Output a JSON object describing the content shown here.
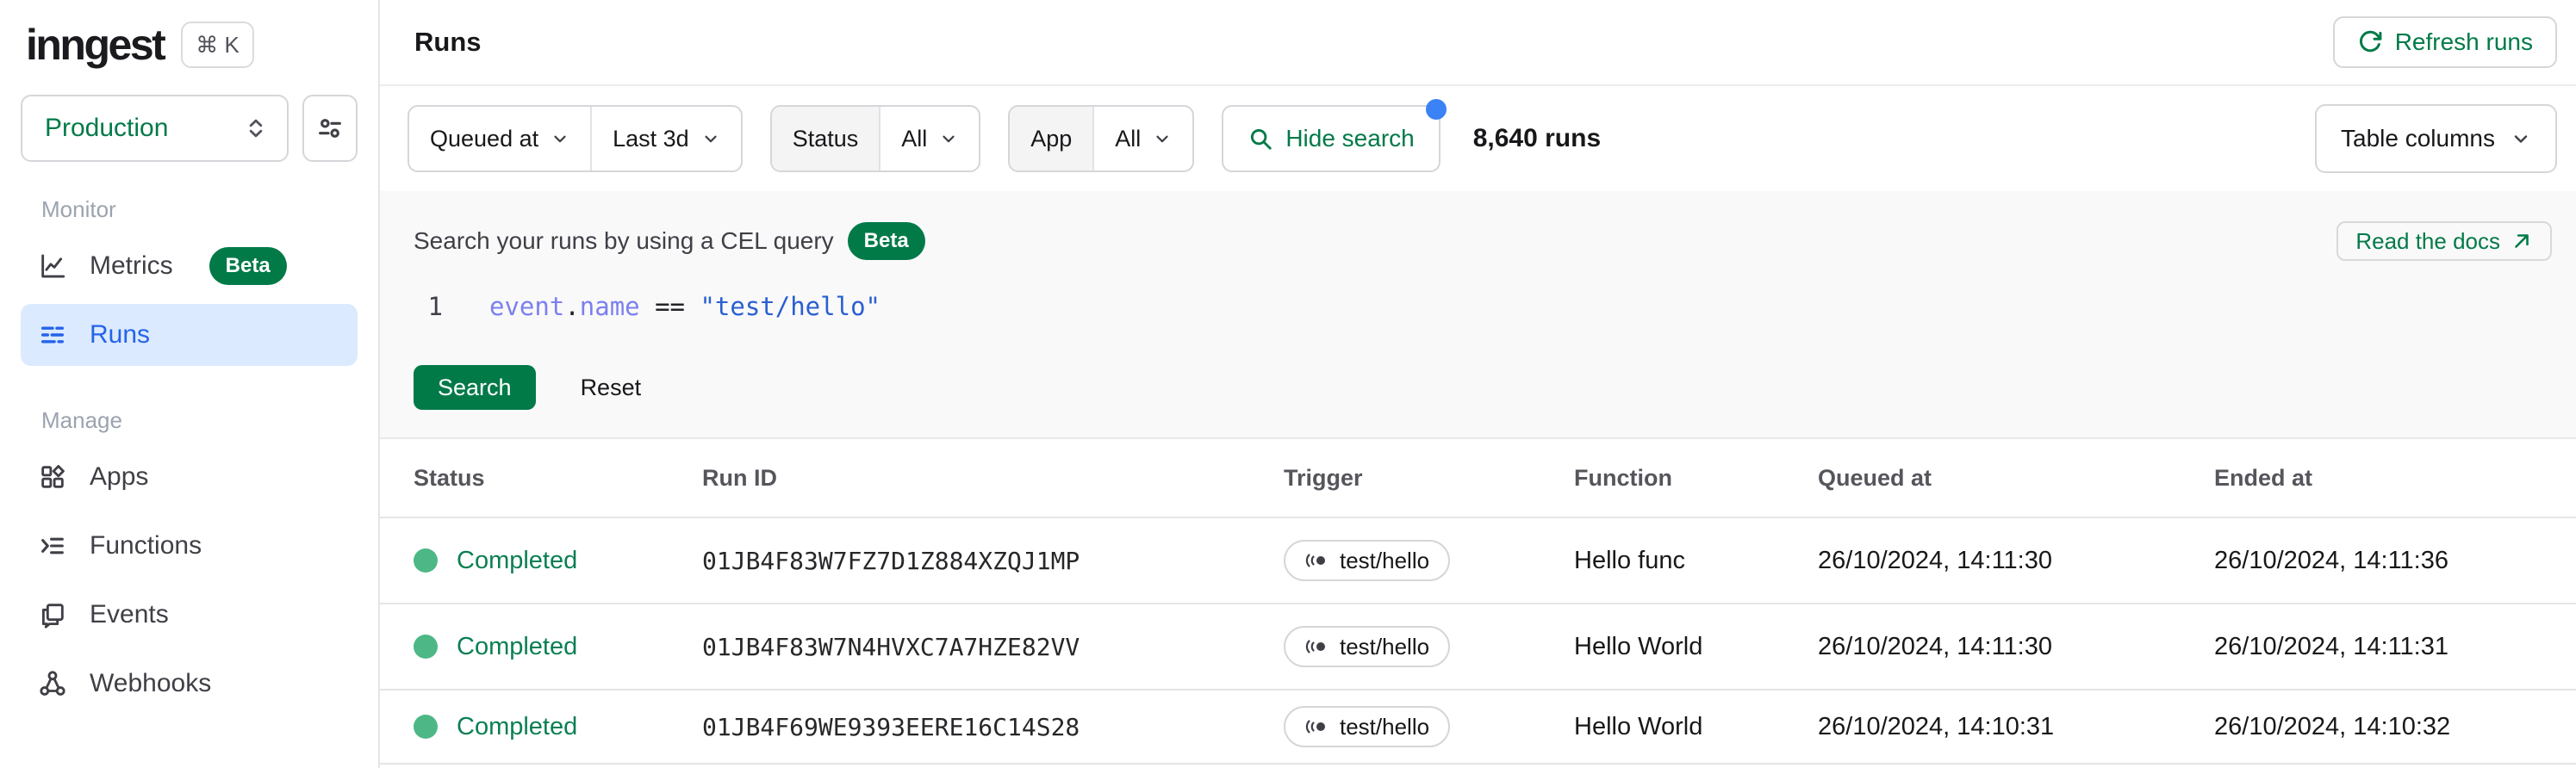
{
  "colors": {
    "brand_green": "#027A48",
    "active_blue": "#2563EB",
    "active_blue_bg": "#DBEAFE",
    "status_dot_green": "#4DB886",
    "notification_blue": "#3B82F6",
    "panel_gray": "#F9F9FA"
  },
  "brand": {
    "logo_text": "inngest",
    "command_shortcut": "⌘ K"
  },
  "sidebar": {
    "environment": "Production",
    "monitor_label": "Monitor",
    "manage_label": "Manage",
    "metrics_label": "Metrics",
    "metrics_badge": "Beta",
    "runs_label": "Runs",
    "apps_label": "Apps",
    "functions_label": "Functions",
    "events_label": "Events",
    "webhooks_label": "Webhooks"
  },
  "header": {
    "title": "Runs",
    "refresh_button": "Refresh runs"
  },
  "filter_bar": {
    "time_field": "Queued at",
    "time_range": "Last 3d",
    "status_label": "Status",
    "status_value": "All",
    "app_label": "App",
    "app_value": "All",
    "search_toggle": "Hide search",
    "runs_count": "8,640 runs",
    "table_columns": "Table columns"
  },
  "search_panel": {
    "title": "Search your runs by using a CEL query",
    "beta_badge": "Beta",
    "docs_button": "Read the docs",
    "editor": {
      "line_number": "1",
      "tokens": {
        "object": "event",
        "dot": ".",
        "property": "name",
        "operator": " == ",
        "string": "\"test/hello\""
      }
    },
    "search_button": "Search",
    "reset_button": "Reset"
  },
  "table": {
    "columns": [
      "Status",
      "Run ID",
      "Trigger",
      "Function",
      "Queued at",
      "Ended at"
    ],
    "rows": [
      {
        "status": "Completed",
        "run_id": "01JB4F83W7FZ7D1Z884XZQJ1MP",
        "trigger": "test/hello",
        "function": "Hello func",
        "queued_at": "26/10/2024, 14:11:30",
        "ended_at": "26/10/2024, 14:11:36"
      },
      {
        "status": "Completed",
        "run_id": "01JB4F83W7N4HVXC7A7HZE82VV",
        "trigger": "test/hello",
        "function": "Hello World",
        "queued_at": "26/10/2024, 14:11:30",
        "ended_at": "26/10/2024, 14:11:31"
      },
      {
        "status": "Completed",
        "run_id": "01JB4F69WE9393EERE16C14S28",
        "trigger": "test/hello",
        "function": "Hello World",
        "queued_at": "26/10/2024, 14:10:31",
        "ended_at": "26/10/2024, 14:10:32"
      }
    ]
  }
}
